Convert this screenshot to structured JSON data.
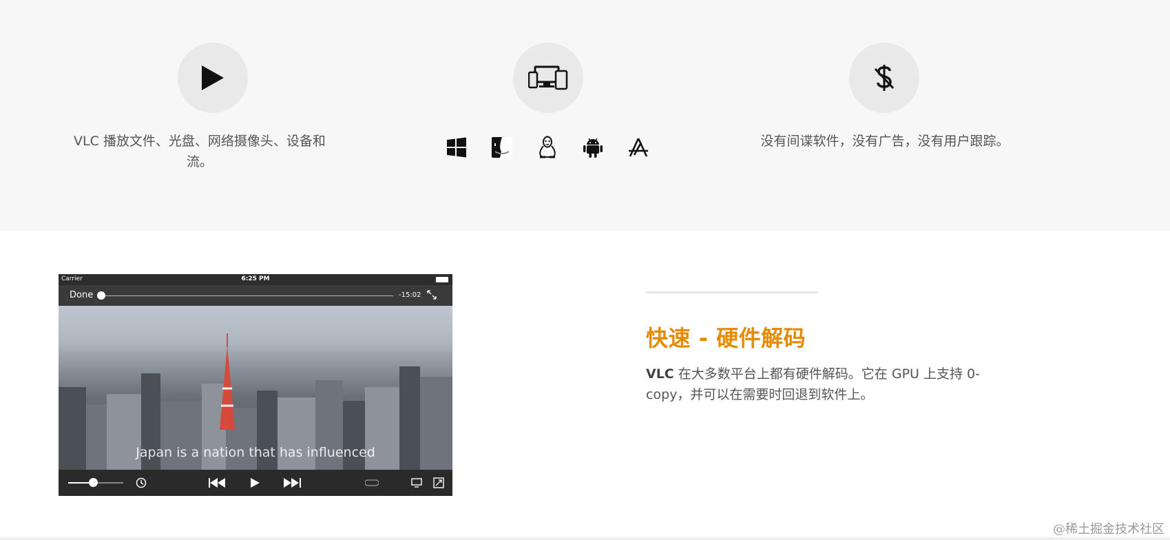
{
  "features": [
    {
      "icon": "play-icon",
      "text": "VLC 播放文件、光盘、网络摄像头、设备和流。"
    },
    {
      "icon": "devices-icon",
      "platforms": [
        "windows-icon",
        "macos-finder-icon",
        "linux-tux-icon",
        "android-icon",
        "app-store-icon"
      ]
    },
    {
      "icon": "no-dollar-icon",
      "text": "没有间谍软件，没有广告，没有用户跟踪。"
    }
  ],
  "player": {
    "carrier": "Carrier",
    "clock": "6:25 PM",
    "done_label": "Done",
    "remaining": "-15:02",
    "subtitle": "Japan is a nation that has influenced",
    "volume_fraction": 0.45,
    "progress_fraction": 0.0
  },
  "section": {
    "heading": "快速 - 硬件解码",
    "desc_strong": "VLC",
    "desc_text": " 在大多数平台上都有硬件解码。它在 GPU 上支持 0-copy，并可以在需要时回退到软件上。"
  },
  "watermark": "@稀土掘金技术社区",
  "colors": {
    "accent": "#e68a00",
    "band": "#f7f7f7",
    "circle": "#e9e9e9"
  }
}
